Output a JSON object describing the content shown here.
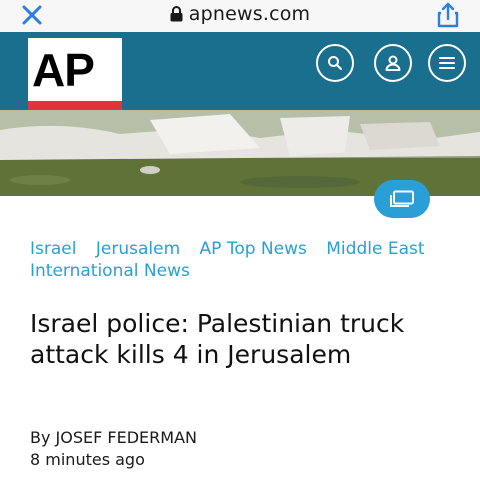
{
  "browser": {
    "url": "apnews.com",
    "close_icon": "close-icon",
    "lock_icon": "lock-icon",
    "share_icon": "share-icon"
  },
  "site": {
    "logo_text": "AP",
    "header_color": "#1a6f8e",
    "logo_accent": "#e3323d",
    "icons": [
      "search-icon",
      "user-icon",
      "menu-icon"
    ]
  },
  "hero": {
    "gallery_icon": "gallery-icon",
    "accent": "#2a9fd6"
  },
  "article": {
    "tags": [
      "Israel",
      "Jerusalem",
      "AP Top News",
      "Middle East",
      "International News"
    ],
    "headline": "Israel police: Palestinian truck attack kills 4 in Jerusalem",
    "byline": "By JOSEF FEDERMAN",
    "timestamp": "8 minutes ago",
    "tag_color": "#2a9fd6"
  }
}
